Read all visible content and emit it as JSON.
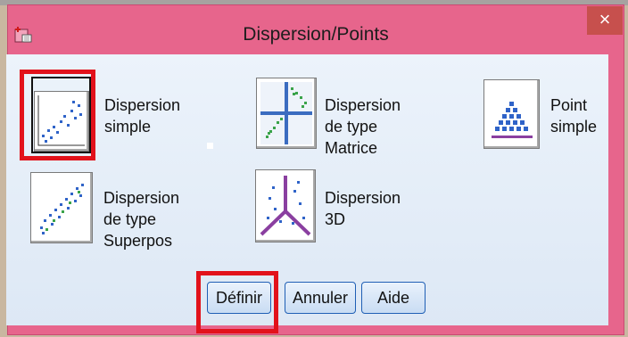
{
  "window": {
    "title": "Dispersion/Points",
    "close_label": "×"
  },
  "options": [
    {
      "label": "Dispersion\nsimple",
      "icon": "simple-scatter-icon"
    },
    {
      "label": "Dispersion de type\nMatrice",
      "icon": "matrix-scatter-icon"
    },
    {
      "label": "Point\nsimple",
      "icon": "simple-dot-icon"
    },
    {
      "label": "Dispersion de type\nSuperpos",
      "icon": "overlay-scatter-icon"
    },
    {
      "label": "Dispersion\n3D",
      "icon": "3d-scatter-icon"
    }
  ],
  "buttons": {
    "define": "Définir",
    "cancel": "Annuler",
    "help": "Aide"
  },
  "colors": {
    "title_bar": "#e7658c",
    "close": "#c7504d",
    "highlight": "#e2121b",
    "client": "#e6eef8"
  }
}
